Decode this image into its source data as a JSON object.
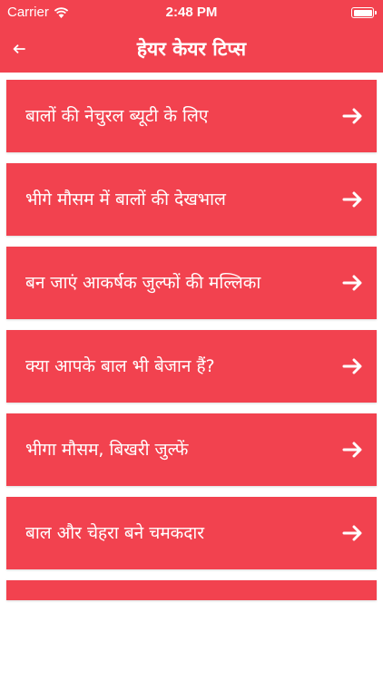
{
  "status_bar": {
    "carrier": "Carrier",
    "time": "2:48 PM",
    "battery_level": 1.0
  },
  "header": {
    "back_icon": "back-arrow-icon",
    "title": "हेयर केयर टिप्स"
  },
  "colors": {
    "accent": "#f2424f",
    "text_on_accent": "#ffffff",
    "background": "#ffffff"
  },
  "tips": [
    {
      "label": "बालों की नेचुरल ब्यूटी के लिए"
    },
    {
      "label": "भीगे मौसम में बालों की देखभाल"
    },
    {
      "label": "बन जाएं आकर्षक जुल्फों की मल्लिका"
    },
    {
      "label": "क्या आपके बाल भी बेजान हैं?"
    },
    {
      "label": "भीगा मौसम, बिखरी जुल्फें"
    },
    {
      "label": "बाल और चेहरा बने चमकदार"
    }
  ]
}
